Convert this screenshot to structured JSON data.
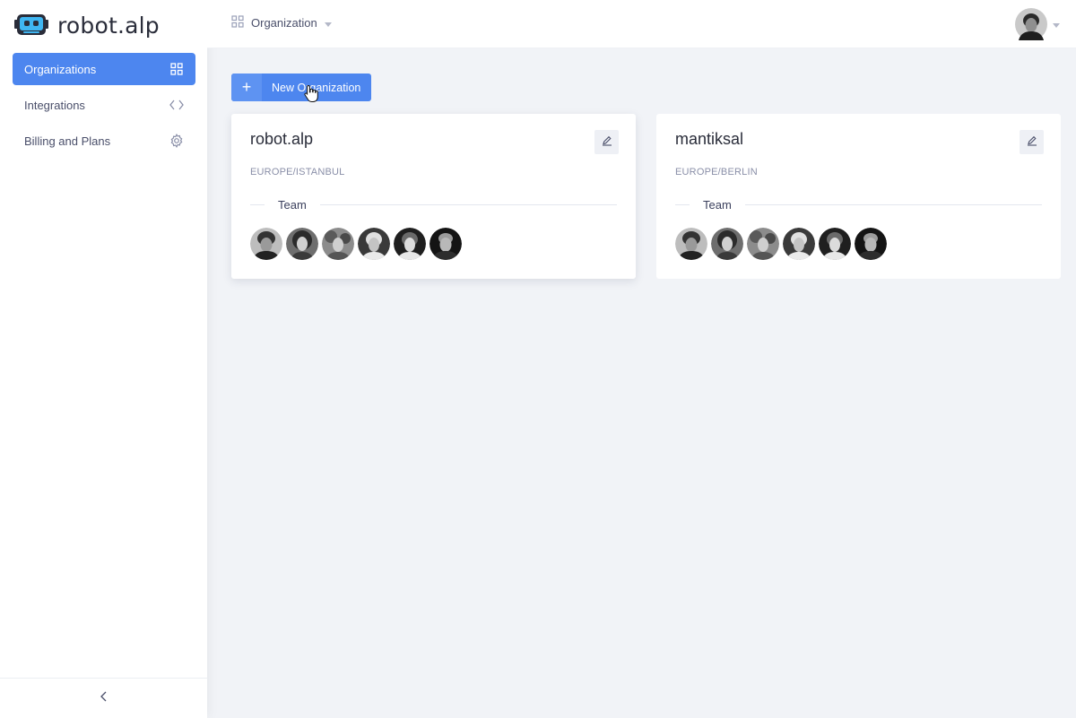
{
  "app": {
    "logo_text": "robot.alp",
    "logo_icon": "robot-icon",
    "accent_color": "#4d86ef"
  },
  "sidebar": {
    "items": [
      {
        "label": "Organizations",
        "icon": "grid-icon",
        "active": true
      },
      {
        "label": "Integrations",
        "icon": "code-icon",
        "active": false
      },
      {
        "label": "Billing and Plans",
        "icon": "gear-icon",
        "active": false
      }
    ],
    "collapse_icon": "chevron-left-icon"
  },
  "header": {
    "breadcrumb_label": "Organization",
    "breadcrumb_icon": "grid-icon"
  },
  "toolbar": {
    "new_org_label": "New Organization"
  },
  "organizations": [
    {
      "name": "robot.alp",
      "timezone": "EUROPE/ISTANBUL",
      "team_label": "Team",
      "members": 6
    },
    {
      "name": "mantiksal",
      "timezone": "EUROPE/BERLIN",
      "team_label": "Team",
      "members": 6
    }
  ]
}
